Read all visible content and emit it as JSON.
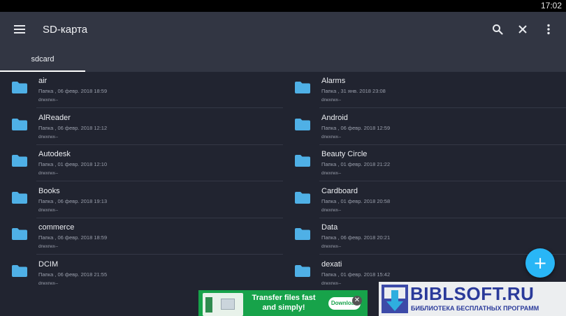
{
  "status_bar": {
    "time": "17:02"
  },
  "toolbar": {
    "menu_icon": "hamburger-menu-icon",
    "title": "SD-карта",
    "search_icon": "search-icon",
    "close_icon": "close-icon",
    "more_icon": "more-vert-icon"
  },
  "tabs": [
    {
      "label": "sdcard",
      "selected": true
    }
  ],
  "colors": {
    "background": "#212430",
    "toolbar": "#323643",
    "folder": "#4fb0e6",
    "accent": "#29b6f6"
  },
  "files": [
    {
      "name": "air",
      "info": "Папка , 06 февр. 2018 18:59",
      "perms": "drwxrwx--"
    },
    {
      "name": "Alarms",
      "info": "Папка , 31 янв. 2018 23:08",
      "perms": "drwxrwx--"
    },
    {
      "name": "AlReader",
      "info": "Папка , 06 февр. 2018 12:12",
      "perms": "drwxrwx--"
    },
    {
      "name": "Android",
      "info": "Папка , 06 февр. 2018 12:59",
      "perms": "drwxrwx--"
    },
    {
      "name": "Autodesk",
      "info": "Папка , 01 февр. 2018 12:10",
      "perms": "drwxrwx--"
    },
    {
      "name": "Beauty Circle",
      "info": "Папка , 01 февр. 2018 21:22",
      "perms": "drwxrwx--"
    },
    {
      "name": "Books",
      "info": "Папка , 06 февр. 2018 19:13",
      "perms": "drwxrwx--"
    },
    {
      "name": "Cardboard",
      "info": "Папка , 01 февр. 2018 20:58",
      "perms": "drwxrwx--"
    },
    {
      "name": "commerce",
      "info": "Папка , 06 февр. 2018 18:59",
      "perms": "drwxrwx--"
    },
    {
      "name": "Data",
      "info": "Папка , 06 февр. 2018 20:21",
      "perms": "drwxrwx--"
    },
    {
      "name": "DCIM",
      "info": "Папка , 06 февр. 2018 21:55",
      "perms": "drwxrwx--"
    },
    {
      "name": "dexati",
      "info": "Папка , 01 февр. 2018 15:42",
      "perms": "drwxrwx--"
    }
  ],
  "fab": {
    "label": "+"
  },
  "ad": {
    "headline": "Transfer files fast and simply!",
    "cta": "Download",
    "close": "✕"
  },
  "watermark": {
    "brand": "BIBLSOFT.RU",
    "tagline": "БИБЛИОТЕКА БЕСПЛАТНЫХ ПРОГРАММ"
  }
}
